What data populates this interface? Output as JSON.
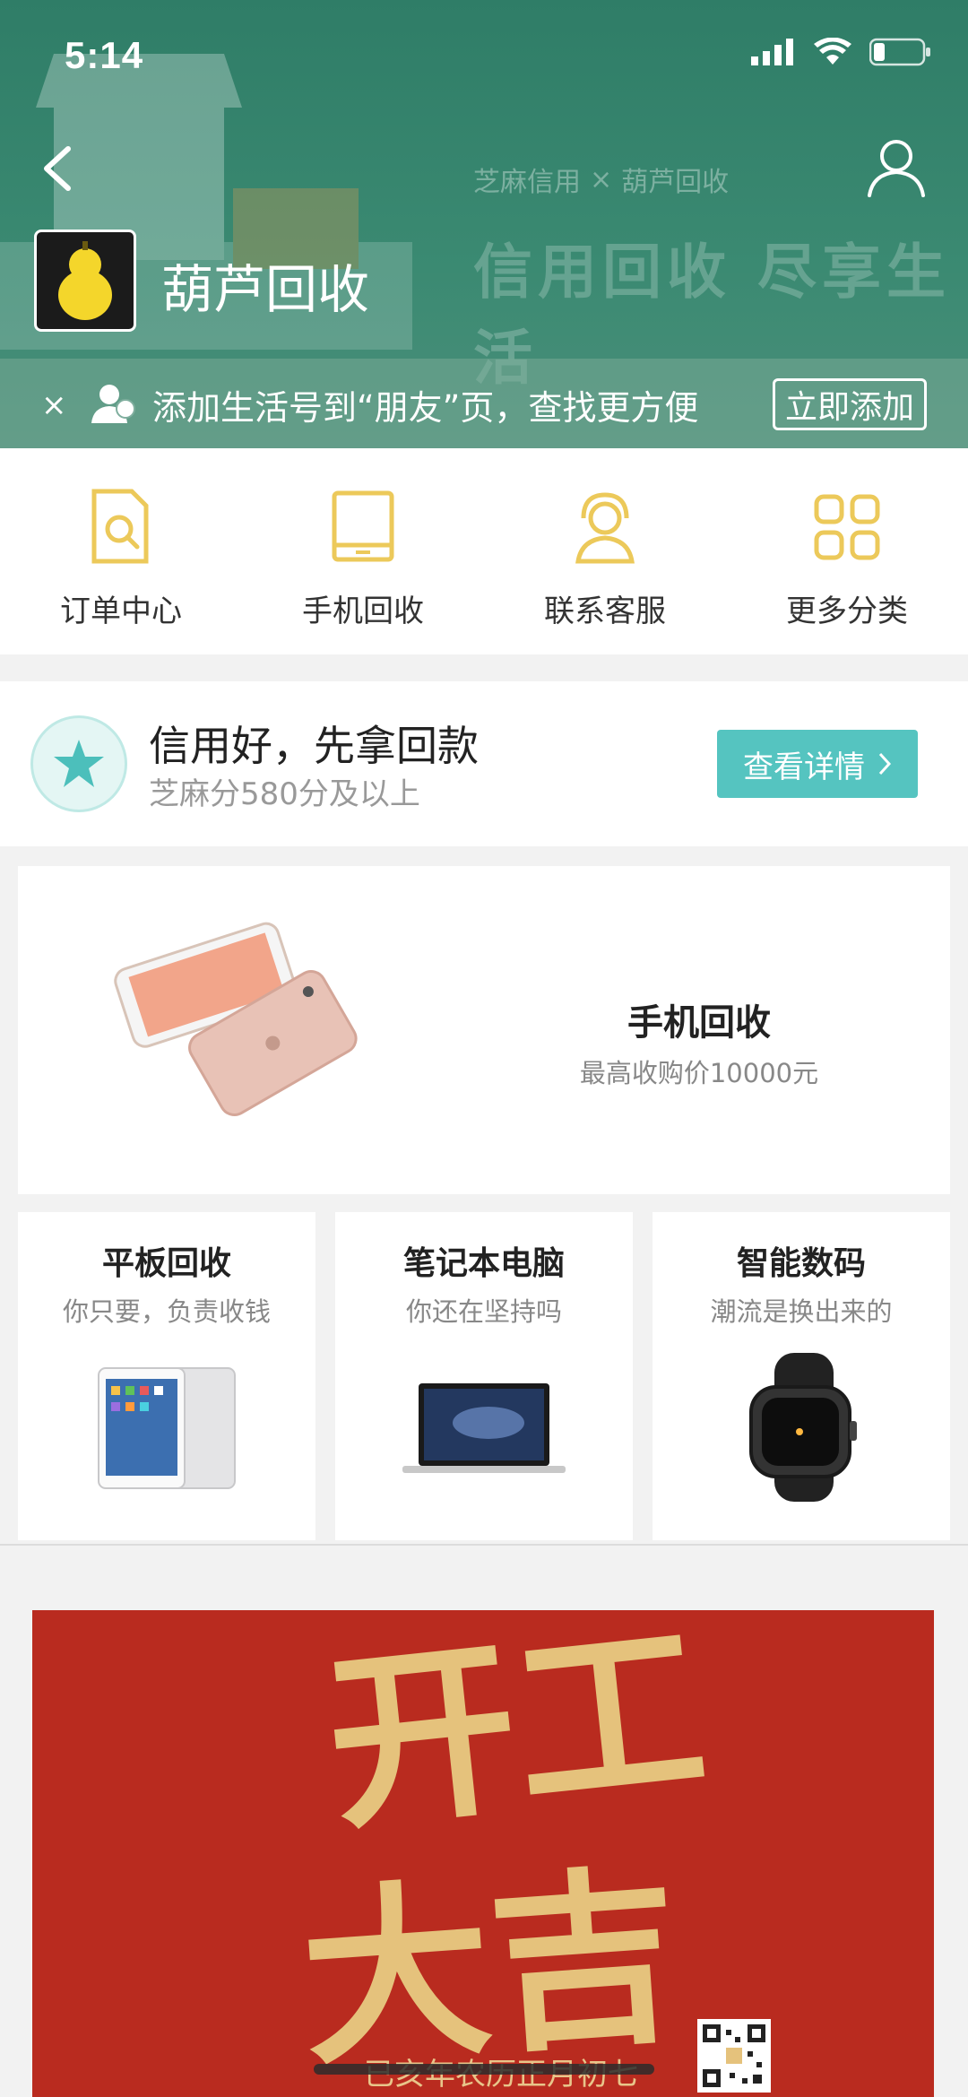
{
  "status_bar": {
    "time": "5:14"
  },
  "header": {
    "title": "葫芦回收",
    "brand_left": "芝麻信用",
    "brand_sep": "×",
    "brand_right": "葫芦回收",
    "slogan": "信用回收 尽享生活",
    "background_color": "#3b8a72"
  },
  "add_bar": {
    "close": "×",
    "text": "添加生活号到“朋友”页，查找更方便",
    "button": "立即添加"
  },
  "quick_nav": [
    {
      "label": "订单中心",
      "icon": "order-icon"
    },
    {
      "label": "手机回收",
      "icon": "tablet-icon"
    },
    {
      "label": "联系客服",
      "icon": "service-icon"
    },
    {
      "label": "更多分类",
      "icon": "grid-icon"
    }
  ],
  "credit": {
    "title": "信用好，先拿回款",
    "subtitle": "芝麻分580分及以上",
    "button": "查看详情",
    "accent": "#55c4c0"
  },
  "phone_card": {
    "title": "手机回收",
    "subtitle": "最高收购价10000元"
  },
  "categories": [
    {
      "title": "平板回收",
      "subtitle": "你只要，负责收钱"
    },
    {
      "title": "笔记本电脑",
      "subtitle": "你还在坚持吗"
    },
    {
      "title": "智能数码",
      "subtitle": "潮流是换出来的"
    }
  ],
  "banner": {
    "line1": "开工",
    "line2": "大吉",
    "caption": "已亥年农历正月初七",
    "background": "#b92b1f"
  }
}
